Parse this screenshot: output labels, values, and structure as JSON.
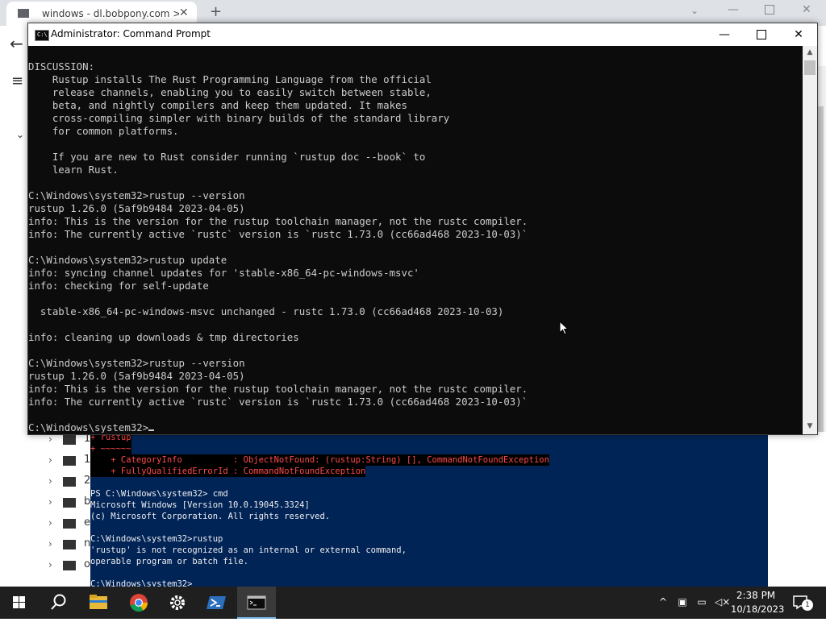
{
  "browser": {
    "tab_title": "windows - dl.bobpony.com > w",
    "tree_labels": [
      "1",
      "1",
      "2",
      "b",
      "e",
      "n",
      "o"
    ]
  },
  "cmd": {
    "title": "Administrator: Command Prompt",
    "lines": [
      "DISCUSSION:",
      "    Rustup installs The Rust Programming Language from the official",
      "    release channels, enabling you to easily switch between stable,",
      "    beta, and nightly compilers and keep them updated. It makes",
      "    cross-compiling simpler with binary builds of the standard library",
      "    for common platforms.",
      "",
      "    If you are new to Rust consider running `rustup doc --book` to",
      "    learn Rust.",
      "",
      "C:\\Windows\\system32>rustup --version",
      "rustup 1.26.0 (5af9b9484 2023-04-05)",
      "info: This is the version for the rustup toolchain manager, not the rustc compiler.",
      "info: The currently active `rustc` version is `rustc 1.73.0 (cc66ad468 2023-10-03)`",
      "",
      "C:\\Windows\\system32>rustup update",
      "info: syncing channel updates for 'stable-x86_64-pc-windows-msvc'",
      "info: checking for self-update",
      "",
      "  stable-x86_64-pc-windows-msvc unchanged - rustc 1.73.0 (cc66ad468 2023-10-03)",
      "",
      "info: cleaning up downloads & tmp directories",
      "",
      "C:\\Windows\\system32>rustup --version",
      "rustup 1.26.0 (5af9b9484 2023-04-05)",
      "info: This is the version for the rustup toolchain manager, not the rustc compiler.",
      "info: The currently active `rustc` version is `rustc 1.73.0 (cc66ad468 2023-10-03)`",
      "",
      "C:\\Windows\\system32>"
    ]
  },
  "powershell": {
    "lines": [
      {
        "text": "+ rustup",
        "style": "err"
      },
      {
        "text": "+ ~~~~~~",
        "style": "err"
      },
      {
        "text": "    + CategoryInfo          : ObjectNotFound: (rustup:String) [], CommandNotFoundException",
        "style": "err"
      },
      {
        "text": "    + FullyQualifiedErrorId : CommandNotFoundException",
        "style": "err"
      },
      {
        "text": "",
        "style": "normal"
      },
      {
        "text": "PS C:\\Windows\\system32> cmd",
        "style": "normal"
      },
      {
        "text": "Microsoft Windows [Version 10.0.19045.3324]",
        "style": "normal"
      },
      {
        "text": "(c) Microsoft Corporation. All rights reserved.",
        "style": "normal"
      },
      {
        "text": "",
        "style": "normal"
      },
      {
        "text": "C:\\Windows\\system32>rustup",
        "style": "normal"
      },
      {
        "text": "'rustup' is not recognized as an internal or external command,",
        "style": "normal"
      },
      {
        "text": "operable program or batch file.",
        "style": "normal"
      },
      {
        "text": "",
        "style": "normal"
      },
      {
        "text": "C:\\Windows\\system32>",
        "style": "normal"
      }
    ]
  },
  "taskbar": {
    "time": "2:38 PM",
    "date": "10/18/2023",
    "notification_count": "1",
    "apps": [
      "start-icon",
      "search-icon",
      "file-explorer-icon",
      "chrome-icon",
      "settings-icon",
      "powershell-icon",
      "command-prompt-icon"
    ]
  },
  "colors": {
    "cmd_bg": "#0c0c0c",
    "ps_bg": "#012456",
    "taskbar_bg": "#1f1f1f"
  }
}
